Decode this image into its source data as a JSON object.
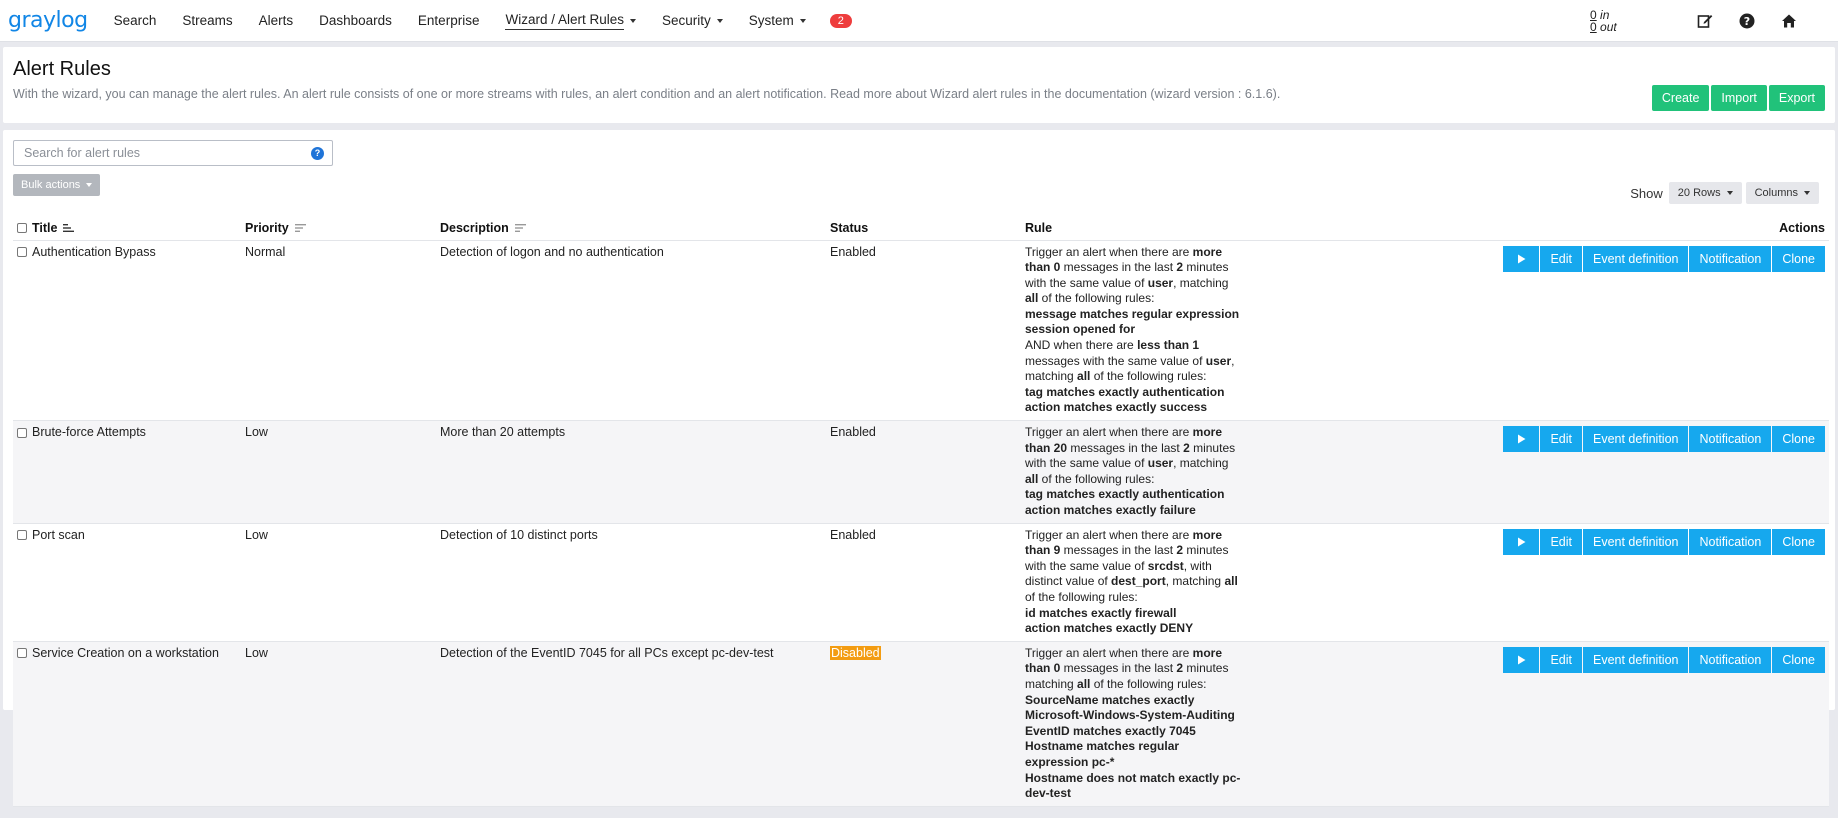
{
  "nav": {
    "brand": "graylog",
    "items": [
      {
        "label": "Search"
      },
      {
        "label": "Streams"
      },
      {
        "label": "Alerts"
      },
      {
        "label": "Dashboards"
      },
      {
        "label": "Enterprise"
      },
      {
        "label": "Wizard / Alert Rules"
      },
      {
        "label": "Security"
      },
      {
        "label": "System"
      }
    ],
    "badge": "2",
    "throughput_in": "0",
    "throughput_in_label": "in",
    "throughput_out": "0",
    "throughput_out_label": "out",
    "icons": [
      "edit-icon",
      "help-icon",
      "home-icon"
    ]
  },
  "header": {
    "title": "Alert Rules",
    "description": "With the wizard, you can manage the alert rules. An alert rule consists of one or more streams with rules, an alert condition and an alert notification. Read more about Wizard alert rules in the documentation (wizard version : 6.1.6).",
    "buttons": {
      "create": "Create",
      "import": "Import",
      "export": "Export"
    }
  },
  "controls": {
    "search_placeholder": "Search for alert rules",
    "bulk_actions": "Bulk actions",
    "show_label": "Show",
    "rows": "20 Rows",
    "columns": "Columns"
  },
  "table": {
    "headers": {
      "title": "Title",
      "priority": "Priority",
      "description": "Description",
      "status": "Status",
      "rule": "Rule",
      "actions": "Actions"
    },
    "action_labels": {
      "edit": "Edit",
      "event": "Event definition",
      "notification": "Notification",
      "clone": "Clone"
    },
    "rows": [
      {
        "title": "Authentication Bypass",
        "priority": "Normal",
        "description": "Detection of logon and no authentication",
        "status": "Enabled"
      },
      {
        "title": "Brute-force Attempts",
        "priority": "Low",
        "description": "More than 20 attempts",
        "status": "Enabled"
      },
      {
        "title": "Port scan",
        "priority": "Low",
        "description": "Detection of 10 distinct ports",
        "status": "Enabled"
      },
      {
        "title": "Service Creation on a workstation",
        "priority": "Low",
        "description": "Detection of the EventID 7045 for all PCs except pc-dev-test",
        "status": "Disabled"
      }
    ]
  },
  "colors": {
    "accent": "#16a8ee",
    "green": "#21c27a",
    "badge": "#ee3d3d",
    "disabled": "#f39c12"
  }
}
